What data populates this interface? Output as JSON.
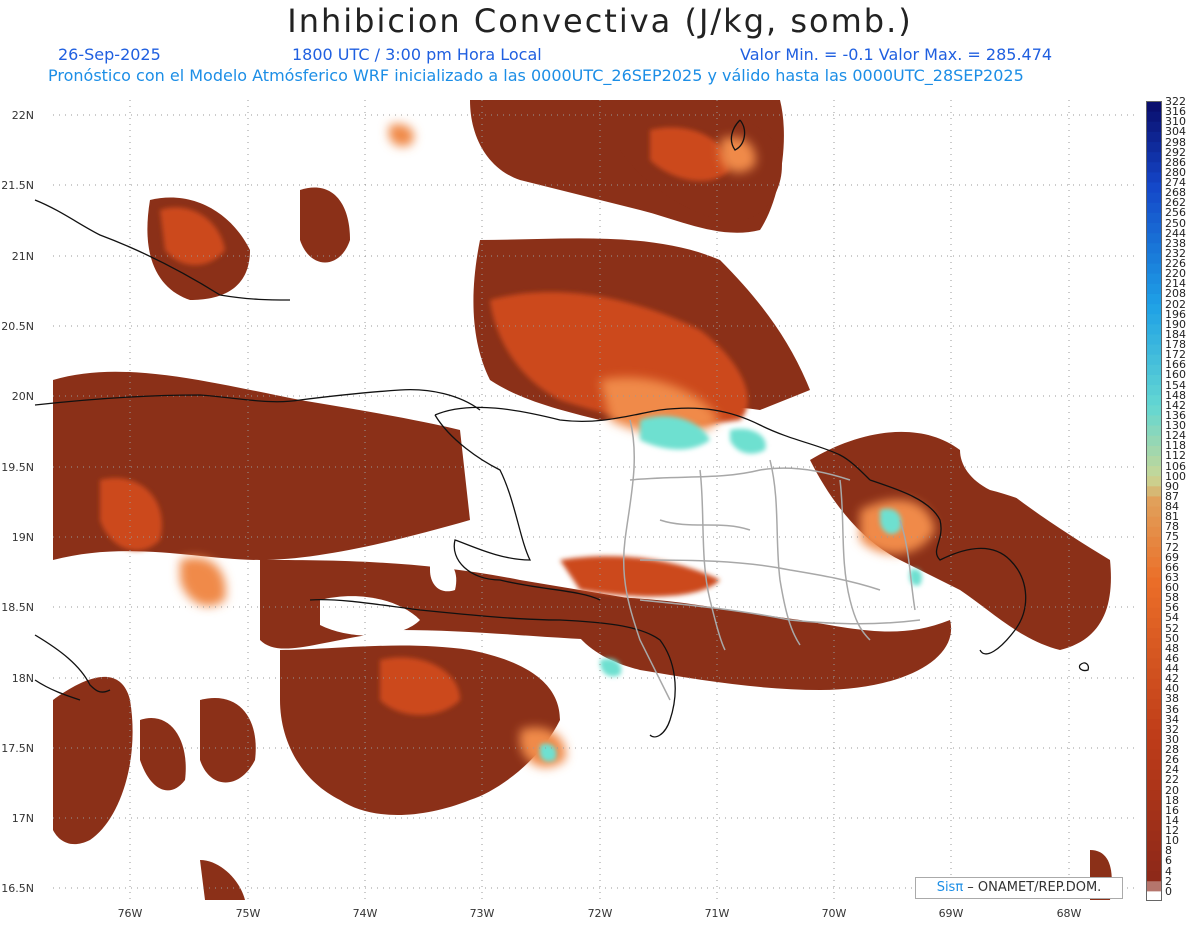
{
  "title": "Inhibicion Convectiva (J/kg, somb.)",
  "date": "26-Sep-2025",
  "utc_time": "1800 UTC / 3:00 pm Hora Local",
  "min_max": "Valor Min. = -0.1  Valor Max. = 285.474",
  "description": "Pronóstico con el Modelo Atmósferico WRF inicializado a las 0000UTC_26SEP2025 y válido hasta las  0000UTC_28SEP2025",
  "credit": {
    "logo": "Sisπ",
    "text": " – ONAMET/REP.DOM."
  },
  "lat_labels": [
    "22N",
    "21.5N",
    "21N",
    "20.5N",
    "20N",
    "19.5N",
    "19N",
    "18.5N",
    "18N",
    "17.5N",
    "17N",
    "16.5N"
  ],
  "lon_labels": [
    "76W",
    "75W",
    "74W",
    "73W",
    "72W",
    "71W",
    "70W",
    "69W",
    "68W"
  ],
  "colorbar_labels": [
    "0",
    "2",
    "4",
    "6",
    "8",
    "10",
    "12",
    "14",
    "16",
    "18",
    "20",
    "22",
    "24",
    "26",
    "28",
    "30",
    "32",
    "34",
    "36",
    "38",
    "40",
    "42",
    "44",
    "46",
    "48",
    "50",
    "52",
    "54",
    "56",
    "58",
    "60",
    "63",
    "66",
    "69",
    "72",
    "75",
    "78",
    "81",
    "84",
    "87",
    "90",
    "100",
    "106",
    "112",
    "118",
    "124",
    "130",
    "136",
    "142",
    "148",
    "154",
    "160",
    "166",
    "172",
    "178",
    "184",
    "190",
    "196",
    "202",
    "208",
    "214",
    "220",
    "226",
    "232",
    "238",
    "244",
    "250",
    "256",
    "262",
    "268",
    "274",
    "280",
    "286",
    "292",
    "298",
    "304",
    "310",
    "316",
    "322"
  ],
  "colors": {
    "low": "#8b3018",
    "mid": "#d85a1e",
    "high": "#f5a060",
    "cyan": "#6ee0d0",
    "title": "#222222",
    "subtitle": "#1f5fe0"
  }
}
